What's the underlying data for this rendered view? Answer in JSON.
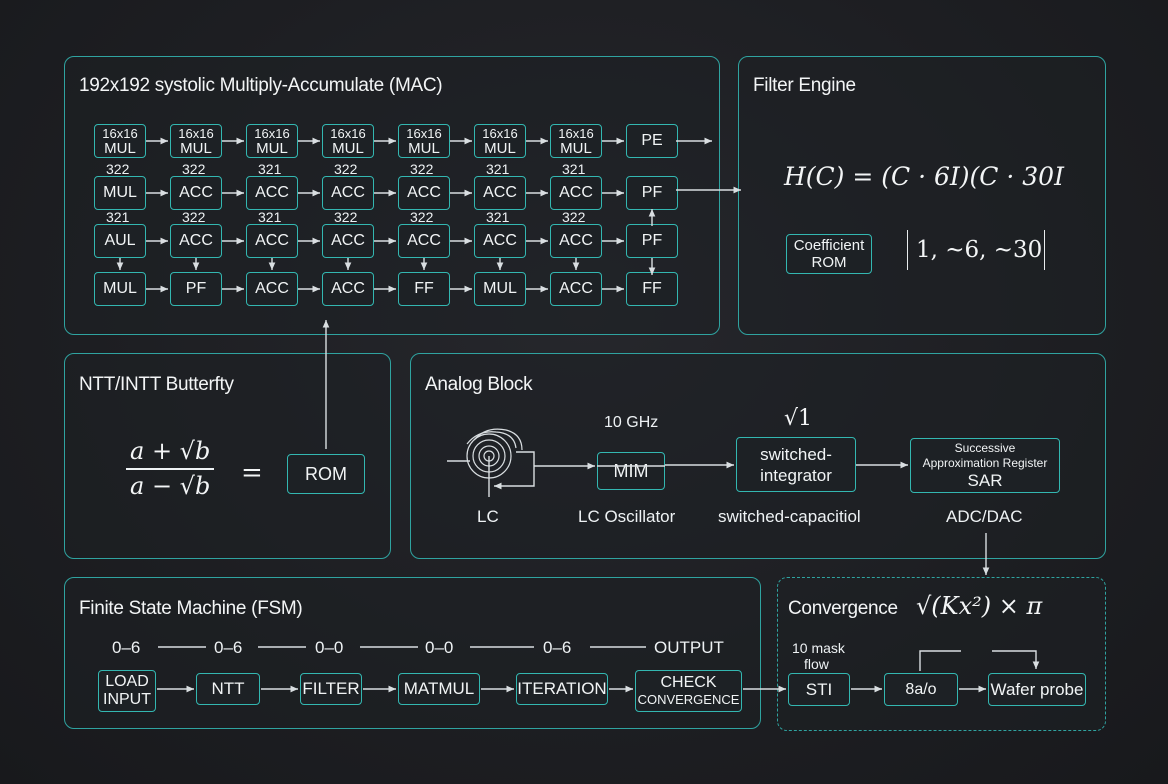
{
  "mac": {
    "title": "192x192 systolic Multiply-Accumulate (MAC)",
    "rows": [
      [
        {
          "top": "16x16",
          "bottom": "MUL"
        },
        {
          "top": "16x16",
          "bottom": "MUL"
        },
        {
          "top": "16x16",
          "bottom": "MUL"
        },
        {
          "top": "16x16",
          "bottom": "MUL"
        },
        {
          "top": "16x16",
          "bottom": "MUL"
        },
        {
          "top": "16x16",
          "bottom": "MUL"
        },
        {
          "top": "16x16",
          "bottom": "MUL"
        },
        {
          "bottom": "PE"
        }
      ],
      [
        {
          "bottom": "MUL"
        },
        {
          "bottom": "ACC"
        },
        {
          "bottom": "ACC"
        },
        {
          "bottom": "ACC"
        },
        {
          "bottom": "ACC"
        },
        {
          "bottom": "ACC"
        },
        {
          "bottom": "ACC"
        },
        {
          "bottom": "PF"
        }
      ],
      [
        {
          "bottom": "AUL"
        },
        {
          "bottom": "ACC"
        },
        {
          "bottom": "ACC"
        },
        {
          "bottom": "ACC"
        },
        {
          "bottom": "ACC"
        },
        {
          "bottom": "ACC"
        },
        {
          "bottom": "ACC"
        },
        {
          "bottom": "PF"
        }
      ],
      [
        {
          "bottom": "MUL"
        },
        {
          "bottom": "PF"
        },
        {
          "bottom": "ACC"
        },
        {
          "bottom": "ACC"
        },
        {
          "bottom": "FF"
        },
        {
          "bottom": "MUL"
        },
        {
          "bottom": "ACC"
        },
        {
          "bottom": "FF"
        }
      ]
    ],
    "row2_numbers": [
      "322",
      "322",
      "321",
      "322",
      "322",
      "321",
      "321"
    ],
    "row3_numbers": [
      "321",
      "322",
      "321",
      "322",
      "322",
      "321",
      "322"
    ]
  },
  "filter": {
    "title": "Filter Engine",
    "equation": "H(C) = (C · 6I)(C · 30I",
    "coef_label_1": "Coefficient",
    "coef_label_2": "ROM",
    "vector": "1,  ~6,  ~30"
  },
  "ntt": {
    "title": "NTT/INTT Butterfty",
    "numerator": "a + √b",
    "denominator": "a − √b",
    "equals": "=",
    "rom": "ROM"
  },
  "analog": {
    "title": "Analog Block",
    "freq": "10 GHz",
    "mim": "MIM",
    "sqrt": "√1",
    "integrator_1": "switched-",
    "integrator_2": "integrator",
    "sar_1": "Successive",
    "sar_2": "Approximation Register",
    "sar_3": "SAR",
    "lc": "LC",
    "lc_osc": "LC Oscillator",
    "switched_cap": "switched-capacitiol",
    "adc": "ADC/DAC"
  },
  "fsm": {
    "title": "Finite State Machine (FSM)",
    "ranges": [
      "0–6",
      "0–6",
      "0–0",
      "0–0",
      "0–6",
      "OUTPUT"
    ],
    "load_1": "LOAD",
    "load_2": "INPUT",
    "states": [
      "NTT",
      "FILTER",
      "MATMUL",
      "ITERATION"
    ],
    "check_1": "CHECK",
    "check_2": "CONVERGENCE"
  },
  "convergence": {
    "title": "Convergence",
    "formula": "√(Kx²) × π",
    "mask_1": "10 mask",
    "mask_2": "flow",
    "steps": [
      "STI",
      "8a/o",
      "Wafer probe"
    ]
  },
  "colors": {
    "accent": "#33b7b1",
    "background": "#1d1e22",
    "wire": "#d9dee1"
  }
}
